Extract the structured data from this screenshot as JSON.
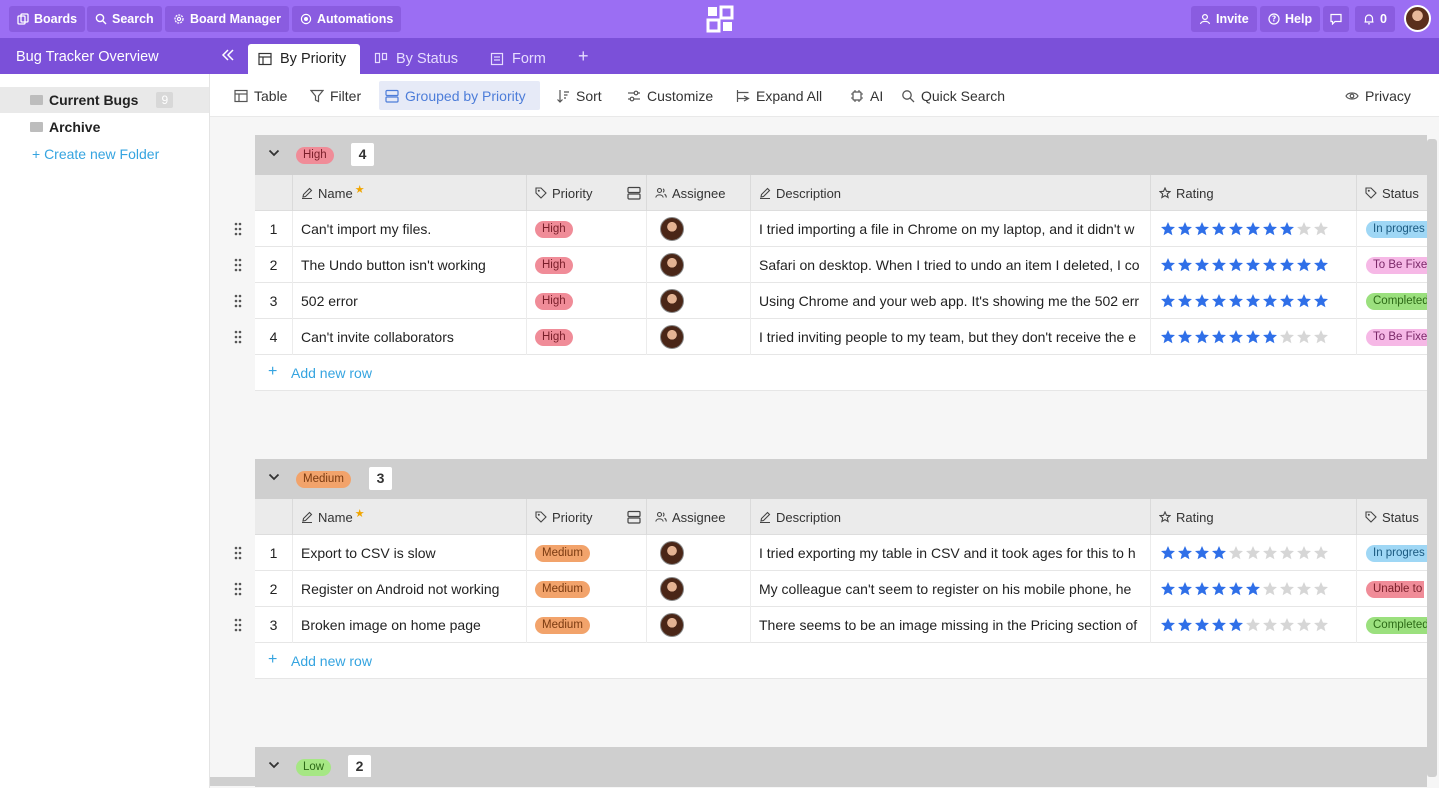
{
  "topbar": {
    "boards": "Boards",
    "search": "Search",
    "board_manager": "Board Manager",
    "automations": "Automations",
    "invite": "Invite",
    "help": "Help",
    "notifications": "0"
  },
  "tabbar": {
    "board_title": "Bug Tracker Overview",
    "tabs": [
      {
        "label": "By Priority",
        "icon": "table-icon"
      },
      {
        "label": "By Status",
        "icon": "kanban-icon"
      },
      {
        "label": "Form",
        "icon": "form-icon"
      }
    ],
    "plus": "+"
  },
  "sidebar": {
    "folders": [
      {
        "label": "Current Bugs",
        "count": "9"
      },
      {
        "label": "Archive"
      }
    ],
    "create_folder": "+ Create new Folder"
  },
  "toolbar": {
    "table": "Table",
    "filter": "Filter",
    "grouped": "Grouped by Priority",
    "sort": "Sort",
    "customize": "Customize",
    "expand_all": "Expand All",
    "ai": "AI",
    "quick_search": "Quick Search",
    "privacy": "Privacy"
  },
  "columns": {
    "name": "Name",
    "priority": "Priority",
    "assignee": "Assignee",
    "description": "Description",
    "rating": "Rating",
    "status": "Status"
  },
  "add_row": "Add new row",
  "colors": {
    "topbar": "#9b6ef3",
    "tabbar": "#7b50d9",
    "link": "#35a4e0",
    "star_on": "#2f6fe8",
    "star_off": "#d6d6d6"
  },
  "groups": [
    {
      "label": "High",
      "count": "4",
      "pill_bg": "#f08c98",
      "pill_fg": "#7a1f2a",
      "rows": [
        {
          "num": "1",
          "name": "Can't import my files.",
          "priority": "High",
          "description": "I tried importing a file in Chrome on my laptop, and it didn't w",
          "rating": 8,
          "status": "In progres",
          "status_bg": "#9fd7f5",
          "status_fg": "#1b5a80"
        },
        {
          "num": "2",
          "name": "The Undo button isn't working",
          "priority": "High",
          "description": "Safari on desktop. When I tried to undo an item I deleted, I co",
          "rating": 10,
          "status": "To Be Fixe",
          "status_bg": "#f6b8e6",
          "status_fg": "#7a2868"
        },
        {
          "num": "3",
          "name": "502 error",
          "priority": "High",
          "description": "Using Chrome and your web app. It's showing me the 502 err",
          "rating": 10,
          "status": "Completed",
          "status_bg": "#9be07e",
          "status_fg": "#2d6a17"
        },
        {
          "num": "4",
          "name": "Can't invite collaborators",
          "priority": "High",
          "description": "I tried inviting people to my team, but they don't receive the e",
          "rating": 7,
          "status": "To Be Fixe",
          "status_bg": "#f6b8e6",
          "status_fg": "#7a2868"
        }
      ]
    },
    {
      "label": "Medium",
      "count": "3",
      "pill_bg": "#f2a36b",
      "pill_fg": "#7a3a10",
      "rows": [
        {
          "num": "1",
          "name": "Export to CSV is slow",
          "priority": "Medium",
          "description": "I tried exporting my table in CSV and it took ages for this to h",
          "rating": 4,
          "status": "In progres",
          "status_bg": "#9fd7f5",
          "status_fg": "#1b5a80"
        },
        {
          "num": "2",
          "name": "Register on Android not working",
          "priority": "Medium",
          "description": "My colleague can't seem to register on his mobile phone, he",
          "rating": 6,
          "status": "Unable to",
          "status_bg": "#f08c98",
          "status_fg": "#7a1f2a"
        },
        {
          "num": "3",
          "name": "Broken image on home page",
          "priority": "Medium",
          "description": "There seems to be an image missing in the Pricing section of",
          "rating": 5,
          "status": "Completed",
          "status_bg": "#9be07e",
          "status_fg": "#2d6a17"
        }
      ]
    },
    {
      "label": "Low",
      "count": "2",
      "pill_bg": "#a6e784",
      "pill_fg": "#2d6a17",
      "rows": []
    }
  ]
}
